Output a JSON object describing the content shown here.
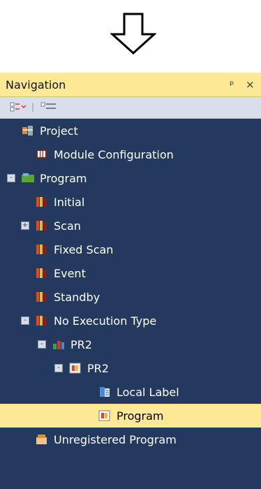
{
  "panel": {
    "title": "Navigation",
    "pin_icon": "pin-icon",
    "close_icon": "close-icon",
    "toolbar": {
      "left_icon": "expand-collapse-icon",
      "right_icon": "collapse-all-icon"
    }
  },
  "tree": [
    {
      "label": "Project",
      "icon": "project-icon",
      "toggle": "",
      "level": 0,
      "selected": false
    },
    {
      "label": "Module Configuration",
      "icon": "module-configuration-icon",
      "toggle": "",
      "level": 1,
      "selected": false
    },
    {
      "label": "Program",
      "icon": "program-folder-icon",
      "toggle": "-",
      "level": 0,
      "selected": false
    },
    {
      "label": "Initial",
      "icon": "program-group-icon",
      "toggle": "",
      "level": 1,
      "selected": false
    },
    {
      "label": "Scan",
      "icon": "program-group-icon",
      "toggle": "+",
      "level": 1,
      "selected": false
    },
    {
      "label": "Fixed Scan",
      "icon": "program-group-icon",
      "toggle": "",
      "level": 1,
      "selected": false
    },
    {
      "label": "Event",
      "icon": "program-group-icon",
      "toggle": "",
      "level": 1,
      "selected": false
    },
    {
      "label": "Standby",
      "icon": "program-group-icon",
      "toggle": "",
      "level": 1,
      "selected": false
    },
    {
      "label": "No Execution Type",
      "icon": "program-group-icon",
      "toggle": "-",
      "level": 1,
      "selected": false
    },
    {
      "label": "PR2",
      "icon": "program-block-icon",
      "toggle": "-",
      "level": 2,
      "selected": false
    },
    {
      "label": "PR2",
      "icon": "program-file-icon",
      "toggle": "-",
      "level": 3,
      "selected": false
    },
    {
      "label": "Local Label",
      "icon": "local-label-icon",
      "toggle": "",
      "level": 4,
      "selected": false
    },
    {
      "label": "Program",
      "icon": "program-body-icon",
      "toggle": "",
      "level": 4,
      "selected": true
    },
    {
      "label": "Unregistered Program",
      "icon": "unregistered-program-icon",
      "toggle": "",
      "level": 1,
      "selected": false
    }
  ]
}
